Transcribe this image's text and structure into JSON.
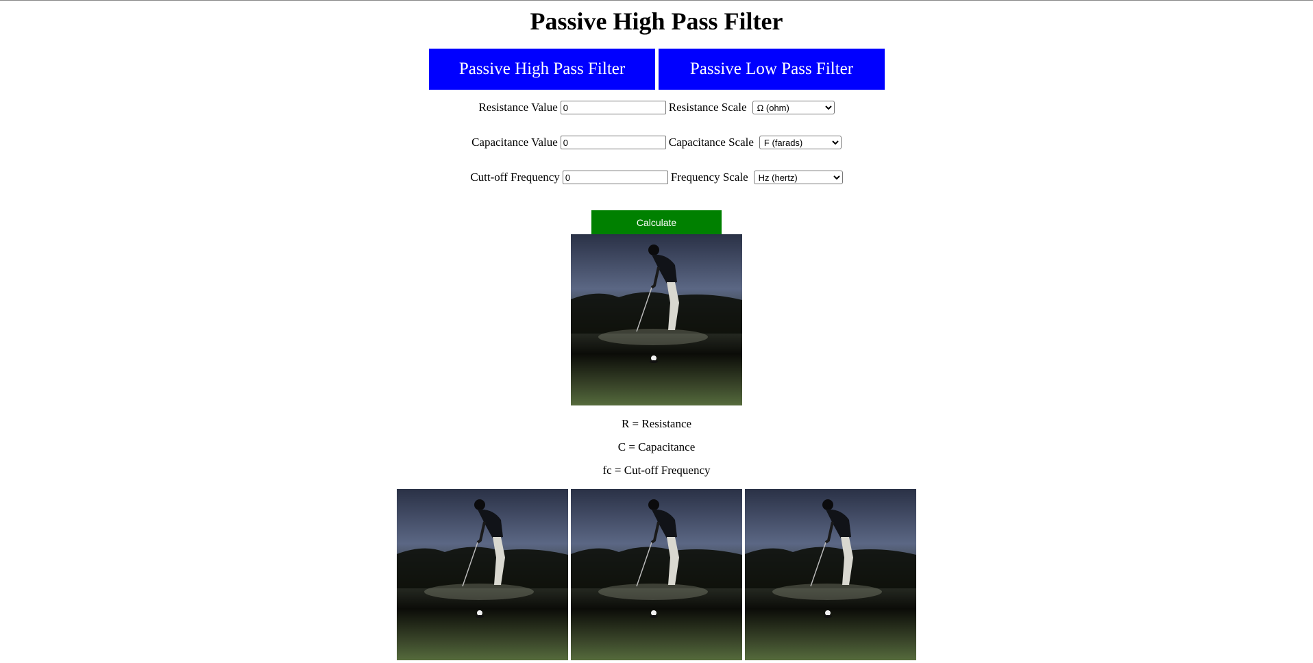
{
  "page": {
    "title": "Passive High Pass Filter"
  },
  "tabs": [
    {
      "label": "Passive High Pass Filter"
    },
    {
      "label": "Passive Low Pass Filter"
    }
  ],
  "form": {
    "resistance": {
      "label": "Resistance Value",
      "value": "0",
      "scale_label": "Resistance Scale",
      "scale_selected": "Ω (ohm)"
    },
    "capacitance": {
      "label": "Capacitance Value",
      "value": "0",
      "scale_label": "Capacitance Scale",
      "scale_selected": "F (farads)"
    },
    "frequency": {
      "label": "Cutt-off Frequency",
      "value": "0",
      "scale_label": "Frequency Scale",
      "scale_selected": "Hz (hertz)"
    },
    "calculate_label": "Calculate"
  },
  "legend": {
    "r": "R = Resistance",
    "c": "C = Capacitance",
    "fc": "fc = Cut-off Frequency"
  },
  "colors": {
    "tab_bg": "#0000ff",
    "button_bg": "#008000"
  }
}
